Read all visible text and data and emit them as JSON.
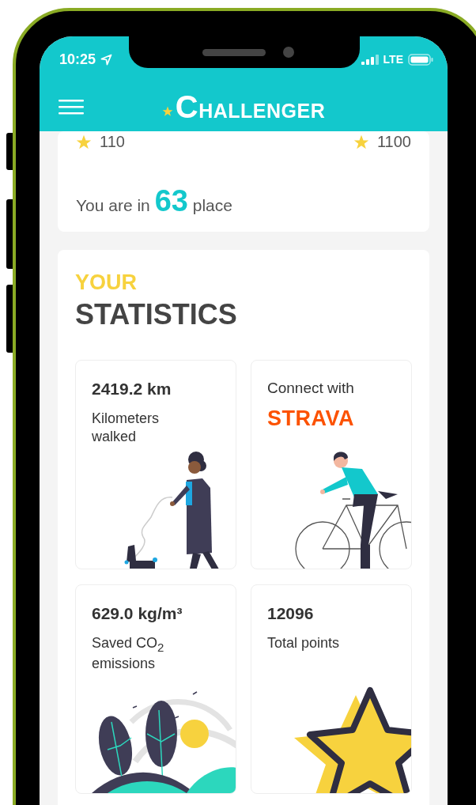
{
  "status_bar": {
    "time": "10:25",
    "network": "LTE"
  },
  "header": {
    "brand": "CHALLENGER"
  },
  "ranking": {
    "points": [
      {
        "value": "110"
      },
      {
        "value": "1100"
      }
    ],
    "place": {
      "before": "You are in",
      "rank": "63",
      "after": "place"
    }
  },
  "statistics": {
    "title_top": "YOUR",
    "title": "STATISTICS",
    "tiles": [
      {
        "kind": "walked",
        "value": "2419.2 km",
        "label": "Kilometers walked"
      },
      {
        "kind": "connect",
        "label": "Connect with",
        "brand": "STRAVA"
      },
      {
        "kind": "co2",
        "value": "629.0 kg/m³",
        "label": "Saved CO$_{2}$ emissions"
      },
      {
        "kind": "points",
        "value": "12096",
        "label": "Total points"
      }
    ]
  }
}
